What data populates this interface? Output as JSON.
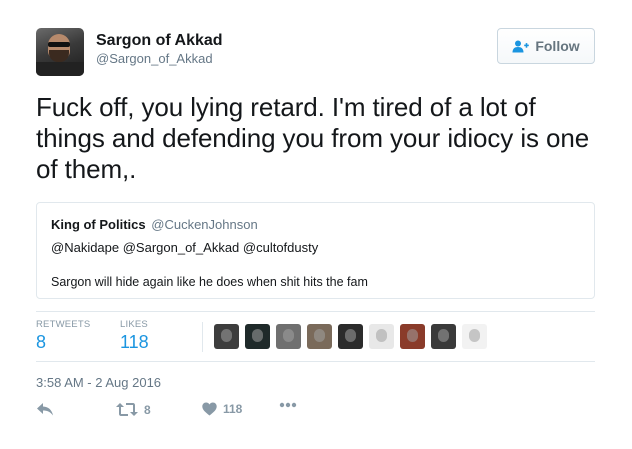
{
  "author": {
    "name": "Sargon of Akkad",
    "handle": "@Sargon_of_Akkad"
  },
  "follow_button": {
    "label": "Follow",
    "icon": "add-user-icon"
  },
  "tweet": {
    "text": "Fuck off, you lying retard. I'm tired of a lot of things and defending you from your idiocy is one of them,."
  },
  "quoted_tweet": {
    "name": "King of Politics",
    "handle": "@CuckenJohnson",
    "line1": "@Nakidape @Sargon_of_Akkad @cultofdusty",
    "line2": "Sargon will hide again like he does when shit hits the fam"
  },
  "stats": {
    "retweets_label": "RETWEETS",
    "retweets_value": "8",
    "likes_label": "LIKES",
    "likes_value": "118"
  },
  "likers": [
    {
      "name": "liker-avatar-1",
      "color": "#3d3d3d"
    },
    {
      "name": "liker-avatar-2",
      "color": "#1f2a2a"
    },
    {
      "name": "liker-avatar-3",
      "color": "#6f6f6f"
    },
    {
      "name": "liker-avatar-4",
      "color": "#7a6a5a"
    },
    {
      "name": "liker-avatar-5",
      "color": "#2b2b2b"
    },
    {
      "name": "liker-avatar-6",
      "color": "#e8e8e8"
    },
    {
      "name": "liker-avatar-7",
      "color": "#8a3b2a"
    },
    {
      "name": "liker-avatar-8",
      "color": "#3a3a3a"
    },
    {
      "name": "liker-avatar-9",
      "color": "#f2f2f2"
    }
  ],
  "timestamp": "3:58 AM - 2 Aug 2016",
  "actions": {
    "reply_icon": "reply-icon",
    "retweet_icon": "retweet-icon",
    "retweet_count": "8",
    "like_icon": "heart-icon",
    "like_count": "118",
    "more_icon": "more-dots-icon"
  },
  "colors": {
    "accent": "#1b95e0",
    "muted": "#8899a6",
    "text": "#14171a",
    "border": "#e1e8ed"
  }
}
